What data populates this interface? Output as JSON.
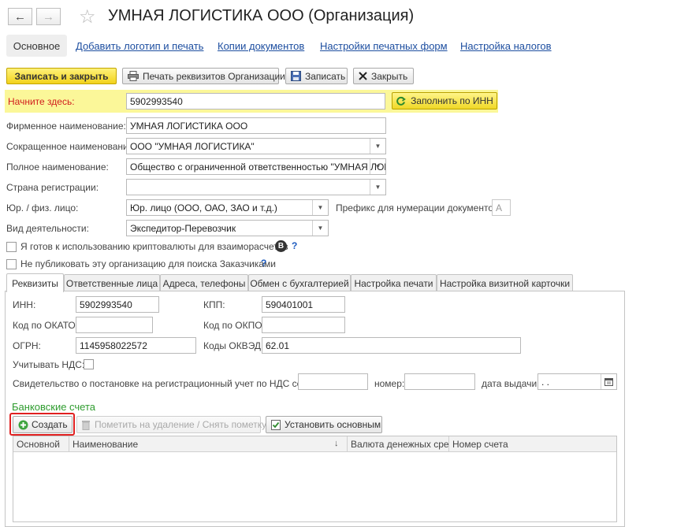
{
  "window": {
    "back_glyph": "←",
    "forward_glyph": "→",
    "star_glyph": "☆",
    "title": "УМНАЯ ЛОГИСТИКА ООО (Организация)"
  },
  "topnav": {
    "active": "Основное",
    "links": [
      "Добавить логотип и печать",
      "Копии документов",
      "Настройки печатных форм",
      "Настройка налогов"
    ]
  },
  "toolbar": {
    "save_close": "Записать и закрыть",
    "print": "Печать реквизитов Организации",
    "save": "Записать",
    "close": "Закрыть"
  },
  "start": {
    "label": "Начните здесь:",
    "value": "5902993540",
    "fill_button": "Заполнить по ИНН"
  },
  "form": {
    "firm_name_label": "Фирменное наименование:",
    "firm_name_value": "УМНАЯ ЛОГИСТИКА ООО",
    "short_name_label": "Сокращенное наименование:",
    "short_name_value": "ООО \"УМНАЯ ЛОГИСТИКА\"",
    "full_name_label": "Полное наименование:",
    "full_name_value": "Общество с ограниченной ответственностью \"УМНАЯ ЛОГИ",
    "country_label": "Страна регистрации:",
    "country_value": "",
    "legal_type_label": "Юр. / физ. лицо:",
    "legal_type_value": "Юр. лицо (ООО, ОАО, ЗАО и т.д.)",
    "prefix_label": "Префикс для нумерации документов :",
    "prefix_placeholder": "А",
    "activity_label": "Вид деятельности:",
    "activity_value": "Экспедитор-Перевозчик",
    "crypto_label": "Я готов к использованию криптовалюты для взаиморасчетов",
    "crypto_icon": "B",
    "nopublish_label": "Не публиковать эту организацию для поиска Заказчиками",
    "help_glyph": "?"
  },
  "tabs": [
    "Реквизиты",
    "Ответственные лица",
    "Адреса, телефоны",
    "Обмен с бухгалтерией",
    "Настройка печати",
    "Настройка визитной карточки"
  ],
  "requisites": {
    "inn_label": "ИНН:",
    "inn_value": "5902993540",
    "kpp_label": "КПП:",
    "kpp_value": "590401001",
    "okato_label": "Код по ОКАТО:",
    "okato_value": "",
    "okpo_label": "Код по ОКПО:",
    "okpo_value": "",
    "ogrn_label": "ОГРН:",
    "ogrn_value": "1145958022572",
    "okved_label": "Коды ОКВЭД:",
    "okved_value": "62.01",
    "vat_label": "Учитывать НДС:",
    "certificate_label": "Свидетельство о постановке на регистрационный учет по НДС серия:",
    "number_label": "номер:",
    "issue_date_label": "дата выдачи:",
    "issue_date_value": " .  ."
  },
  "bank": {
    "title": "Банковские счета",
    "create": "Создать",
    "mark_delete": "Пометить на удаление / Снять пометку",
    "set_main": "Установить основным",
    "columns": [
      "Основной",
      "Наименование",
      "Валюта денежных сре...",
      "Номер счета"
    ],
    "sort_glyph": "↓"
  },
  "colors": {
    "highlight": "#fbf799",
    "primary_button": "#f2d21c",
    "link": "#1d4ea0",
    "required_label": "#d11d1d",
    "section_title": "#2f9c2f",
    "focus_frame": "#e02020"
  }
}
